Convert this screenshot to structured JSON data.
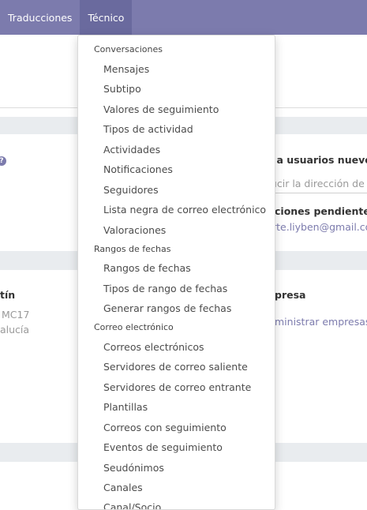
{
  "navbar": {
    "items": [
      {
        "label": "Traducciones"
      },
      {
        "label": "Técnico"
      }
    ]
  },
  "background": {
    "invite_title": "r a usuarios nuevos",
    "invite_placeholder": "ducir la dirección de c",
    "pending_title": "ciones pendientes:",
    "pending_email": "rte.liyben@gmail.com",
    "left_heading": "tín",
    "left_line1": "MC17",
    "left_line2": "alucía",
    "company_heading": "presa",
    "company_link": "ministrar empresas",
    "help_icon_glyph": "?"
  },
  "menu": {
    "sections": [
      {
        "header": "Conversaciones",
        "items": [
          "Mensajes",
          "Subtipo",
          "Valores de seguimiento",
          "Tipos de actividad",
          "Actividades",
          "Notificaciones",
          "Seguidores",
          "Lista negra de correo electrónico",
          "Valoraciones"
        ]
      },
      {
        "header": "Rangos de fechas",
        "items": [
          "Rangos de fechas",
          "Tipos de rango de fechas",
          "Generar rangos de fechas"
        ]
      },
      {
        "header": "Correo electrónico",
        "items": [
          "Correos electrónicos",
          "Servidores de correo saliente",
          "Servidores de correo entrante",
          "Plantillas",
          "Correos con seguimiento",
          "Eventos de seguimiento",
          "Seudónimos",
          "Canales",
          "Canal/Socio"
        ]
      }
    ]
  }
}
